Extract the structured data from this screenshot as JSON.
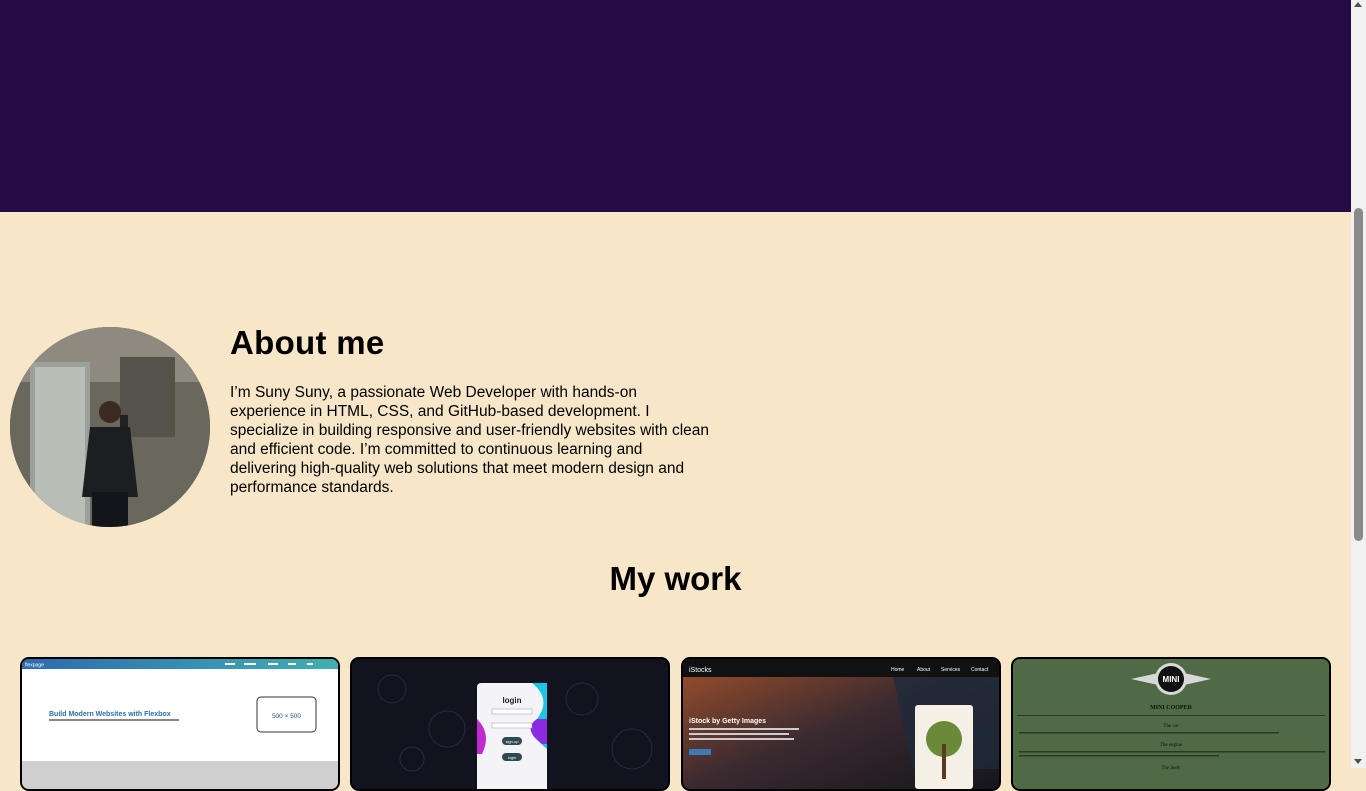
{
  "about": {
    "title": "About me",
    "text": "I’m Suny Suny, a passionate Web Developer with hands-on experience in HTML, CSS, and GitHub-based development. I specialize in building responsive and user-friendly websites with clean and efficient code. I’m committed to continuous learning and delivering high-quality web solutions that meet modern design and performance standards."
  },
  "work": {
    "title": "My work",
    "projects": [
      {
        "nav_brand": "flexpage",
        "heading": "Build Modern Websites with Flexbox",
        "box_label": "500 × 500"
      },
      {
        "form_title": "login",
        "button_1": "sign-up",
        "button_2": "login"
      },
      {
        "brand": "iStocks",
        "nav": [
          "Home",
          "About",
          "Services",
          "Contact"
        ],
        "heading": "iStock by Getty Images"
      },
      {
        "logo": "MINI",
        "title": "MINI COOPER",
        "section_1": "The car",
        "section_2": "The engine",
        "section_3": "The body"
      }
    ]
  },
  "colors": {
    "hero": "#240b43",
    "page_bg": "#f7e6c8"
  }
}
